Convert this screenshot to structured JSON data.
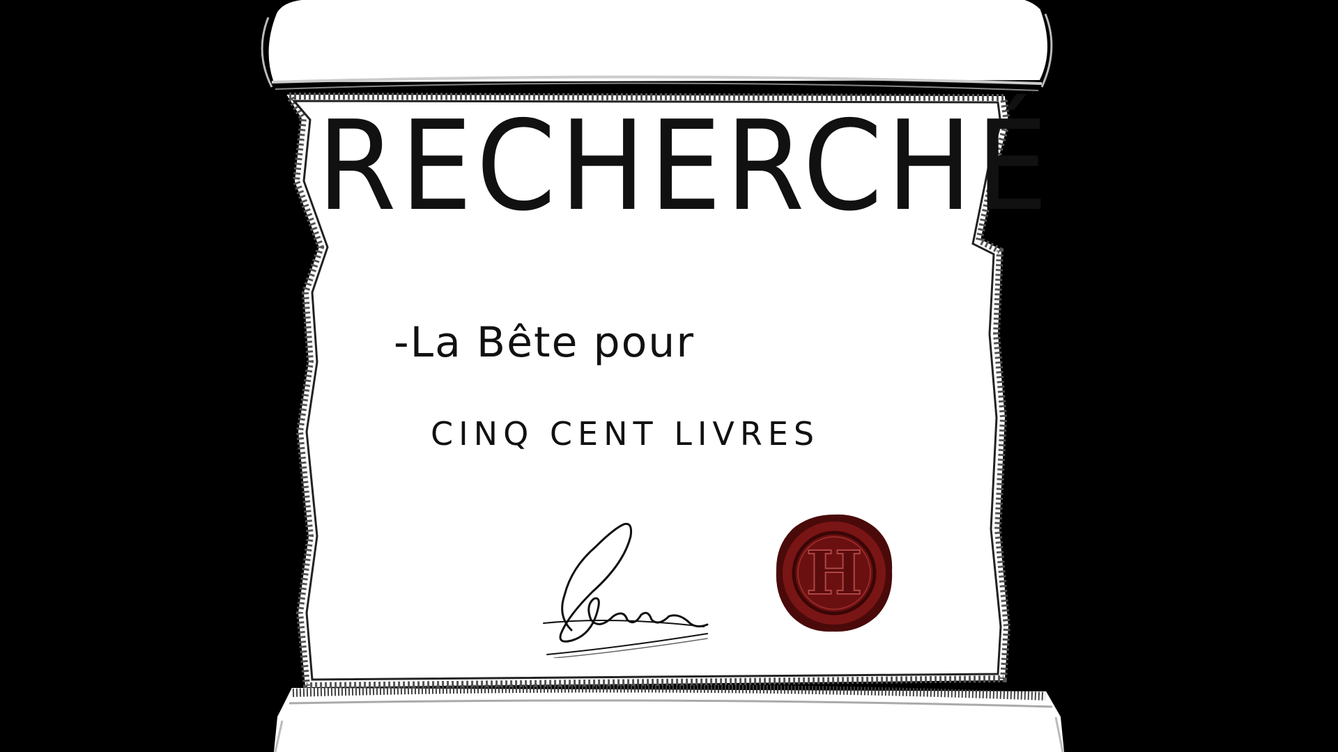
{
  "poster": {
    "title": "RECHERCHÉ",
    "subject": "-La Bête pour",
    "reward": "CINQ CENT LIVRES"
  },
  "seal": {
    "letter": "H",
    "color": "#7a1515",
    "rim_color": "#4a0a0a"
  },
  "colors": {
    "background": "#000000",
    "paper": "#ffffff",
    "ink": "#111111"
  }
}
